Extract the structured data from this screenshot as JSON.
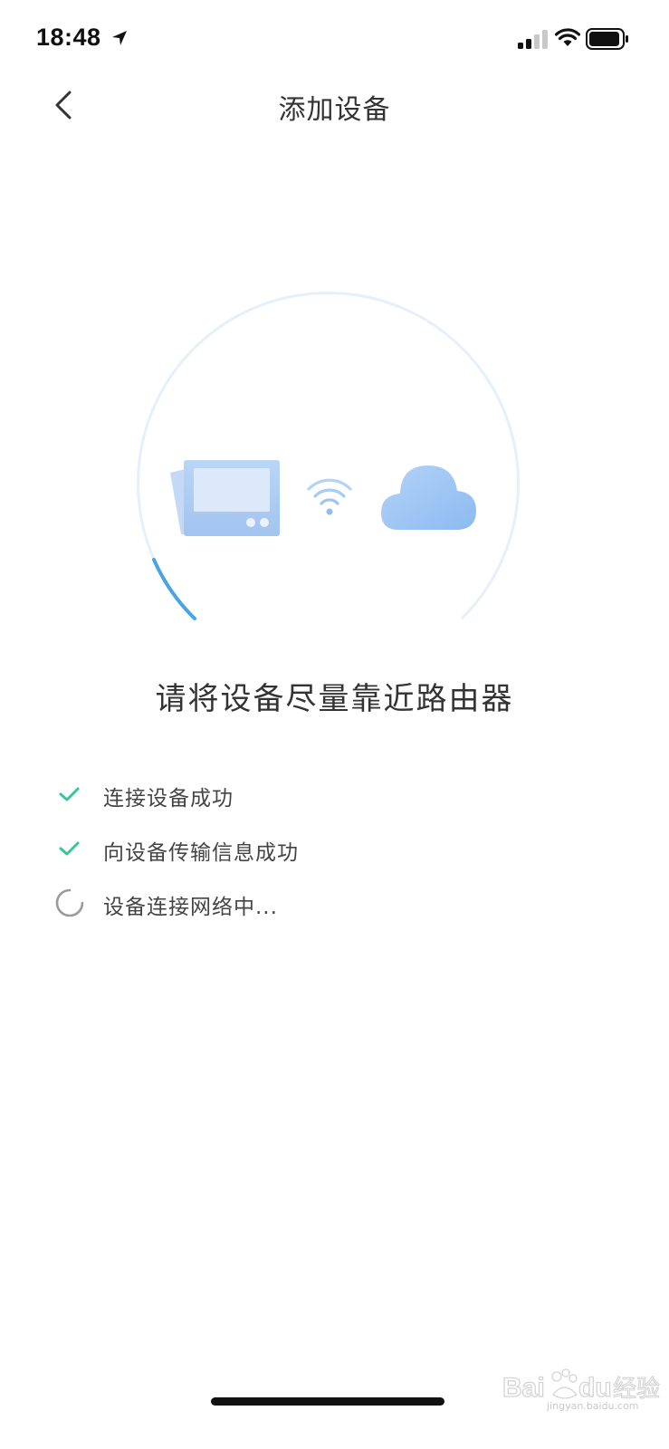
{
  "status_bar": {
    "time": "18:48",
    "icons": [
      "location-arrow-icon",
      "signal-icon",
      "wifi-icon",
      "battery-icon"
    ]
  },
  "nav": {
    "title": "添加设备",
    "back_icon": "chevron-left-icon"
  },
  "illustration": {
    "icons": [
      "device-icon",
      "wifi-icon",
      "cloud-icon"
    ],
    "progress_fraction": 0.08,
    "colors": {
      "ring": "#e4f0fb",
      "progress": "#4aa3e3",
      "device": "#a9cbf3",
      "cloud": "#9ec6f5"
    }
  },
  "hint": "请将设备尽量靠近路由器",
  "steps": [
    {
      "label": "连接设备成功",
      "status": "done",
      "icon": "check-icon"
    },
    {
      "label": "向设备传输信息成功",
      "status": "done",
      "icon": "check-icon"
    },
    {
      "label": "设备连接网络中...",
      "status": "loading",
      "icon": "spinner-icon"
    }
  ],
  "colors": {
    "check": "#3cc39c",
    "spinner": "#9a9a9a"
  }
}
